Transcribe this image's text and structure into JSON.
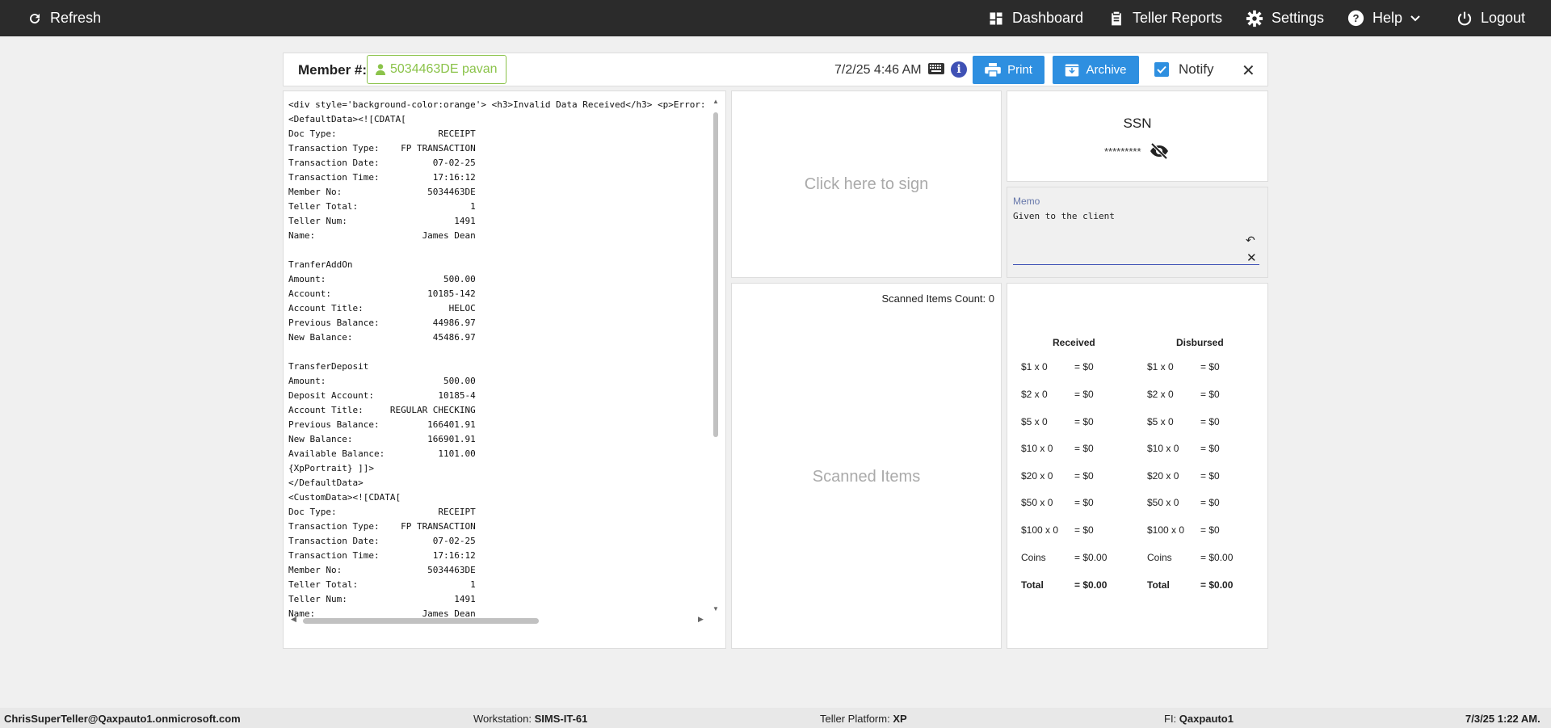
{
  "nav": {
    "refresh": "Refresh",
    "dashboard": "Dashboard",
    "teller_reports": "Teller Reports",
    "settings": "Settings",
    "help": "Help",
    "logout": "Logout"
  },
  "header": {
    "member_label": "Member #:",
    "member_value": "5034463DE pavan",
    "datetime": "7/2/25 4:46 AM",
    "print": "Print",
    "archive": "Archive",
    "notify": "Notify",
    "notify_checked": true
  },
  "receipt": {
    "lines": [
      "<div style='background-color:orange'> <h3>Invalid Data Received</h3> <p>Error:",
      "<DefaultData><![CDATA[",
      "Doc Type:                   RECEIPT",
      "Transaction Type:    FP TRANSACTION",
      "Transaction Date:          07-02-25",
      "Transaction Time:          17:16:12",
      "Member No:                5034463DE",
      "Teller Total:                     1",
      "Teller Num:                    1491",
      "Name:                    James Dean",
      "",
      "TranferAddOn",
      "Amount:                      500.00",
      "Account:                  10185-142",
      "Account Title:                HELOC",
      "Previous Balance:          44986.97",
      "New Balance:               45486.97",
      "",
      "TransferDeposit",
      "Amount:                      500.00",
      "Deposit Account:            10185-4",
      "Account Title:     REGULAR CHECKING",
      "Previous Balance:         166401.91",
      "New Balance:              166901.91",
      "Available Balance:          1101.00",
      "{XpPortrait} ]]>",
      "</DefaultData>",
      "<CustomData><![CDATA[",
      "Doc Type:                   RECEIPT",
      "Transaction Type:    FP TRANSACTION",
      "Transaction Date:          07-02-25",
      "Transaction Time:          17:16:12",
      "Member No:                5034463DE",
      "Teller Total:                     1",
      "Teller Num:                    1491",
      "Name:                    James Dean"
    ]
  },
  "signature": {
    "prompt": "Click here to sign"
  },
  "scanned": {
    "count_label": "Scanned Items Count: 0",
    "title": "Scanned Items"
  },
  "ssn": {
    "title": "SSN",
    "masked": "*********"
  },
  "memo": {
    "label": "Memo",
    "value": "Given to the client"
  },
  "cash": {
    "received_header": "Received",
    "disbursed_header": "Disbursed",
    "received": [
      {
        "label": "$1 x 0",
        "value": "= $0"
      },
      {
        "label": "$2 x 0",
        "value": "= $0"
      },
      {
        "label": "$5 x 0",
        "value": "= $0"
      },
      {
        "label": "$10 x 0",
        "value": "= $0"
      },
      {
        "label": "$20 x 0",
        "value": "= $0"
      },
      {
        "label": "$50 x 0",
        "value": "= $0"
      },
      {
        "label": "$100 x 0",
        "value": "= $0"
      },
      {
        "label": "Coins",
        "value": "= $0.00"
      },
      {
        "label": "Total",
        "value": "= $0.00"
      }
    ],
    "disbursed": [
      {
        "label": "$1 x 0",
        "value": "= $0"
      },
      {
        "label": "$2 x 0",
        "value": "= $0"
      },
      {
        "label": "$5 x 0",
        "value": "= $0"
      },
      {
        "label": "$10 x 0",
        "value": "= $0"
      },
      {
        "label": "$20 x 0",
        "value": "= $0"
      },
      {
        "label": "$50 x 0",
        "value": "= $0"
      },
      {
        "label": "$100 x 0",
        "value": "= $0"
      },
      {
        "label": "Coins",
        "value": "= $0.00"
      },
      {
        "label": "Total",
        "value": "= $0.00"
      }
    ]
  },
  "footer": {
    "user": "ChrisSuperTeller@Qaxpauto1.onmicrosoft.com",
    "workstation_label": "Workstation:",
    "workstation": "SIMS-IT-61",
    "platform_label": "Teller Platform:",
    "platform": "XP",
    "fi_label": "FI:",
    "fi": "Qaxpauto1",
    "datetime": "7/3/25 1:22 AM."
  },
  "colors": {
    "topbar": "#2b2b2b",
    "accent_blue": "#2e8fe0",
    "member_green": "#8bc34a",
    "info_indigo": "#3f51b5"
  }
}
